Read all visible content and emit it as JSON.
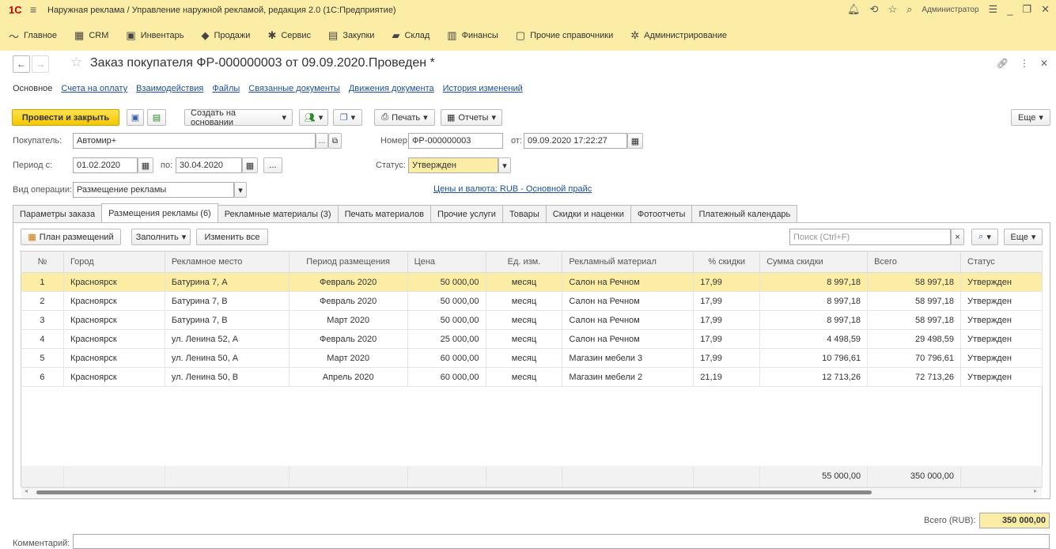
{
  "app": {
    "logo": "1С",
    "title": "Наружная реклама / Управление наружной рекламой, редакция 2.0  (1С:Предприятие)",
    "user": "Администратор"
  },
  "menu": [
    {
      "icon": "chart-line-icon",
      "glyph": "〜",
      "label": "Главное"
    },
    {
      "icon": "crm-icon",
      "glyph": "▦",
      "label": "CRM"
    },
    {
      "icon": "inventory-icon",
      "glyph": "▣",
      "label": "Инвентарь"
    },
    {
      "icon": "sales-icon",
      "glyph": "◆",
      "label": "Продажи"
    },
    {
      "icon": "service-icon",
      "glyph": "✱",
      "label": "Сервис"
    },
    {
      "icon": "purchases-icon",
      "glyph": "▤",
      "label": "Закупки"
    },
    {
      "icon": "warehouse-icon",
      "glyph": "▰",
      "label": "Склад"
    },
    {
      "icon": "finance-icon",
      "glyph": "▥",
      "label": "Финансы"
    },
    {
      "icon": "catalogs-icon",
      "glyph": "▢",
      "label": "Прочие справочники"
    },
    {
      "icon": "admin-icon",
      "glyph": "✲",
      "label": "Администрирование"
    }
  ],
  "doc": {
    "title": "Заказ покупателя ФР-000000003 от 09.09.2020.Проведен *"
  },
  "links": {
    "current": "Основное",
    "items": [
      "Счета на оплату",
      "Взаимодействия",
      "Файлы",
      "Связанные документы",
      "Движения документа",
      "История изменений"
    ]
  },
  "toolbar": {
    "post_close": "Провести и закрыть",
    "create_based": "Создать на основании",
    "print": "Печать",
    "reports": "Отчеты",
    "more": "Еще"
  },
  "form": {
    "buyer_label": "Покупатель:",
    "buyer_value": "Автомир+",
    "number_label": "Номер:",
    "number_value": "ФР-000000003",
    "from_label": "от:",
    "date_value": "09.09.2020 17:22:27",
    "period_label": "Период с:",
    "period_from": "01.02.2020",
    "period_to_label": "по:",
    "period_to": "30.04.2020",
    "dots": "...",
    "status_label": "Статус:",
    "status_value": "Утвержден",
    "op_label": "Вид операции:",
    "op_value": "Размещение рекламы",
    "prices_link": "Цены и валюта: RUB - Основной прайс"
  },
  "tabs": [
    "Параметры заказа",
    "Размещения рекламы (6)",
    "Рекламные материалы (3)",
    "Печать материалов",
    "Прочие услуги",
    "Товары",
    "Скидки и наценки",
    "Фотоотчеты",
    "Платежный календарь"
  ],
  "grid_toolbar": {
    "plan": "План размещений",
    "fill": "Заполнить",
    "change_all": "Изменить все",
    "search_placeholder": "Поиск (Ctrl+F)",
    "more": "Еще"
  },
  "columns": [
    "№",
    "Город",
    "Рекламное место",
    "Период размещения",
    "Цена",
    "Ед. изм.",
    "Рекламный материал",
    "% скидки",
    "Сумма скидки",
    "Всего",
    "Статус"
  ],
  "rows": [
    [
      "1",
      "Красноярск",
      "Батурина 7, А",
      "Февраль 2020",
      "50 000,00",
      "месяц",
      "Салон на Речном",
      "17,99",
      "8 997,18",
      "58 997,18",
      "Утвержден"
    ],
    [
      "2",
      "Красноярск",
      "Батурина 7, В",
      "Февраль 2020",
      "50 000,00",
      "месяц",
      "Салон на Речном",
      "17,99",
      "8 997,18",
      "58 997,18",
      "Утвержден"
    ],
    [
      "3",
      "Красноярск",
      "Батурина 7, В",
      "Март 2020",
      "50 000,00",
      "месяц",
      "Салон на Речном",
      "17,99",
      "8 997,18",
      "58 997,18",
      "Утвержден"
    ],
    [
      "4",
      "Красноярск",
      "ул. Ленина 52, А",
      "Февраль 2020",
      "25 000,00",
      "месяц",
      "Салон на Речном",
      "17,99",
      "4 498,59",
      "29 498,59",
      "Утвержден"
    ],
    [
      "5",
      "Красноярск",
      "ул. Ленина 50, А",
      "Март 2020",
      "60 000,00",
      "месяц",
      "Магазин мебели 3",
      "17,99",
      "10 796,61",
      "70 796,61",
      "Утвержден"
    ],
    [
      "6",
      "Красноярск",
      "ул. Ленина 50, В",
      "Апрель 2020",
      "60 000,00",
      "месяц",
      "Магазин мебели 2",
      "21,19",
      "12 713,26",
      "72 713,26",
      "Утвержден"
    ]
  ],
  "totals": {
    "discount": "55 000,00",
    "total": "350 000,00"
  },
  "bottom": {
    "total_label": "Всего (RUB):",
    "total_value": "350 000,00",
    "comment_label": "Комментарий:"
  },
  "colors": {
    "accent": "#fbeda5",
    "primary_button": "#f5c800",
    "link": "#1d4f9c"
  }
}
